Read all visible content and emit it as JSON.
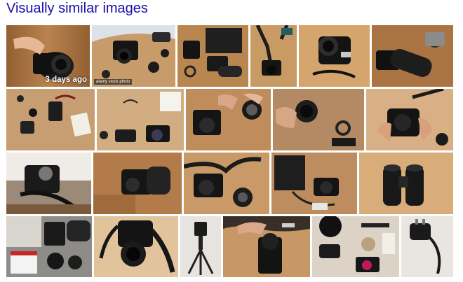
{
  "heading": {
    "text": "Visually similar images"
  },
  "colors": {
    "heading_link": "#1a0dab"
  },
  "rows": [
    {
      "images": [
        {
          "name": "hands-holding-camera-on-wood-table",
          "badge": "3 days ago",
          "bg": "#a8723f"
        },
        {
          "name": "camera-and-accessories-on-table",
          "watermark": "alamy stock photo",
          "bg": "#c89b6a"
        },
        {
          "name": "camera-bag-and-lenses",
          "bg": "#b9864f"
        },
        {
          "name": "camera-with-strap-on-table",
          "bg": "#c89a64"
        },
        {
          "name": "black-camera-top-view",
          "bg": "#d4a56c"
        },
        {
          "name": "camera-with-long-lens",
          "bg": "#a97441"
        }
      ]
    },
    {
      "images": [
        {
          "name": "vintage-lenses-and-glasses",
          "bg": "#c79e72"
        },
        {
          "name": "cameras-and-notebook",
          "bg": "#d2ad82"
        },
        {
          "name": "hands-with-camera-and-lens",
          "bg": "#bf8d5b"
        },
        {
          "name": "hand-holding-lens",
          "bg": "#b48a64"
        },
        {
          "name": "hands-with-nikon-camera",
          "bg": "#d9b085"
        }
      ]
    },
    {
      "images": [
        {
          "name": "camera-on-stand-with-strap",
          "bg": "#9c8a78"
        },
        {
          "name": "camera-with-lens-on-floor",
          "bg": "#b37b49"
        },
        {
          "name": "camera-with-strap-and-lens",
          "bg": "#c99a68"
        },
        {
          "name": "camera-bag-and-camera",
          "bg": "#be8d5f"
        },
        {
          "name": "black-binoculars",
          "bg": "#d8ad7a"
        }
      ]
    },
    {
      "images": [
        {
          "name": "camera-box-and-lenses",
          "bg": "#8d8c89"
        },
        {
          "name": "canon-camera-with-strap",
          "bg": "#e1c49c"
        },
        {
          "name": "mini-tripod",
          "bg": "#e7e4df"
        },
        {
          "name": "hands-with-battery-grip",
          "bg": "#c79766"
        },
        {
          "name": "camera-gear-flatlay",
          "bg": "#dcd3c6"
        },
        {
          "name": "black-charger-and-cable",
          "bg": "#e9e6e2"
        }
      ]
    }
  ]
}
